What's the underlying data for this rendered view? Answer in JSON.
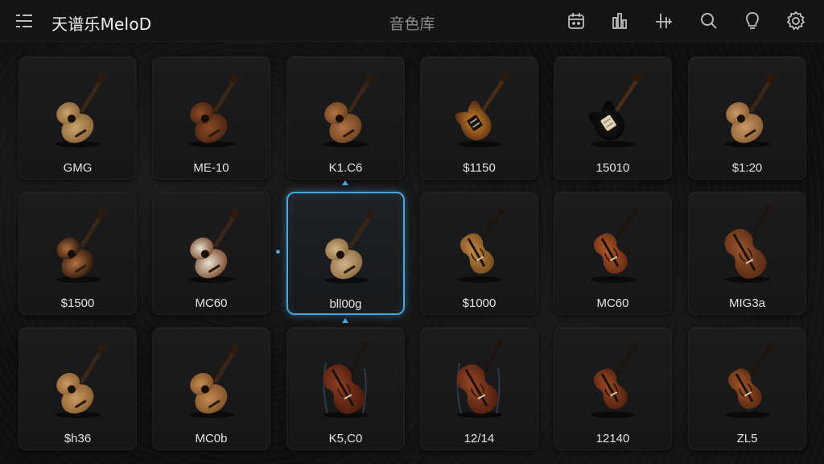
{
  "header": {
    "app_name": "天谱乐MeloD",
    "page_title": "音色库",
    "icons": [
      "menu-icon",
      "calendar-icon",
      "equalizer-icon",
      "waveform-icon",
      "search-icon",
      "bulb-icon",
      "gear-icon"
    ]
  },
  "instruments": [
    {
      "label": "GMG",
      "kind": "acoustic",
      "body": "#c9a36b",
      "dark": "#8a6238"
    },
    {
      "label": "ME-10",
      "kind": "acoustic",
      "body": "#8a4a26",
      "dark": "#4a2412"
    },
    {
      "label": "K1.C6",
      "kind": "acoustic",
      "body": "#b27444",
      "dark": "#6e4020"
    },
    {
      "label": "$1150",
      "kind": "electric",
      "body": "#5a2c12",
      "dark": "#d08a2c"
    },
    {
      "label": "15010",
      "kind": "electric-black",
      "body": "#1a1a1a",
      "dark": "#e6d2aa"
    },
    {
      "label": "$1:20",
      "kind": "acoustic",
      "body": "#c99a66",
      "dark": "#8a5e34"
    },
    {
      "label": "$1500",
      "kind": "acoustic-burst",
      "body": "#b07040",
      "dark": "#3a1e10"
    },
    {
      "label": "MC60",
      "kind": "acoustic-white",
      "body": "#e8e0d4",
      "dark": "#7a4a2a"
    },
    {
      "label": "bll00g",
      "kind": "acoustic",
      "body": "#d2b486",
      "dark": "#8c6a40"
    },
    {
      "label": "$1000",
      "kind": "violin",
      "body": "#c48a46",
      "dark": "#7a4e1e"
    },
    {
      "label": "MC60",
      "kind": "violin",
      "body": "#b0582c",
      "dark": "#6a2e12"
    },
    {
      "label": "MIG3a",
      "kind": "cello",
      "body": "#9a5430",
      "dark": "#5a2c14"
    },
    {
      "label": "$h36",
      "kind": "acoustic",
      "body": "#c99a62",
      "dark": "#8a5e30"
    },
    {
      "label": "MC0b",
      "kind": "acoustic",
      "body": "#c48c52",
      "dark": "#7e5028"
    },
    {
      "label": "K5,C0",
      "kind": "cello-stand",
      "body": "#8e3e22",
      "dark": "#4c1c0c"
    },
    {
      "label": "12/14",
      "kind": "cello-stand",
      "body": "#9a4826",
      "dark": "#50200e"
    },
    {
      "label": "12140",
      "kind": "violin",
      "body": "#9c4a26",
      "dark": "#52220e"
    },
    {
      "label": "ZL5",
      "kind": "violin",
      "body": "#a6562c",
      "dark": "#5a2a12"
    }
  ],
  "selected_index": 8,
  "accent_color": "#4aa6dc"
}
